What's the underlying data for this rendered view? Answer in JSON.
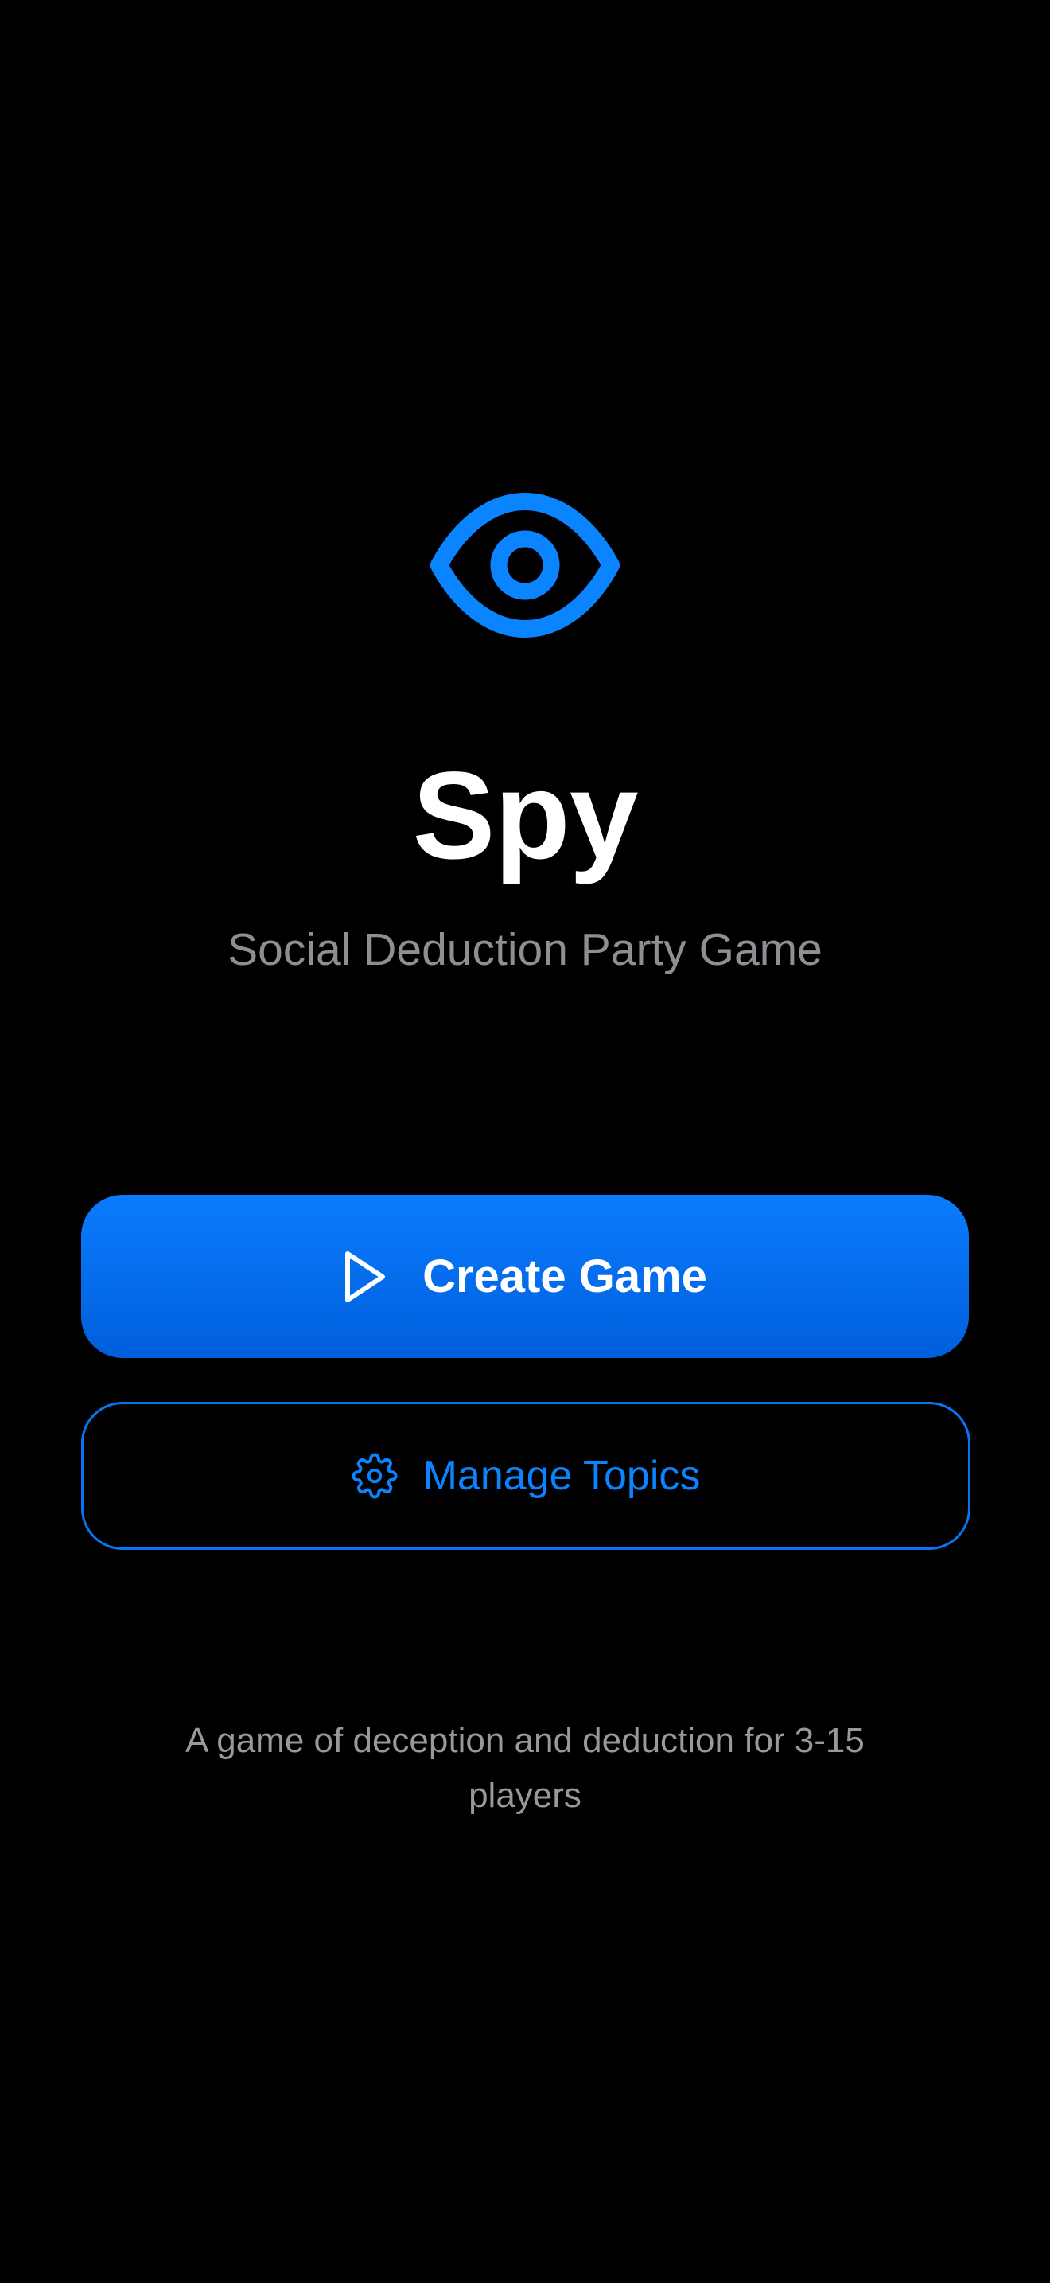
{
  "app": {
    "title": "Spy",
    "subtitle": "Social Deduction Party Game",
    "logo_icon": "eye-icon"
  },
  "actions": {
    "create_game": {
      "label": "Create Game",
      "icon": "play-icon"
    },
    "manage_topics": {
      "label": "Manage Topics",
      "icon": "gear-icon"
    }
  },
  "footer": {
    "text": "A game of deception and deduction for 3-15 players"
  },
  "colors": {
    "background": "#000000",
    "accent": "#0a84ff",
    "primary_button_top": "#0a7cff",
    "primary_button_bottom": "#005fdb",
    "title": "#ffffff",
    "subtitle": "#8e8e93",
    "footer_text": "#98989d"
  }
}
